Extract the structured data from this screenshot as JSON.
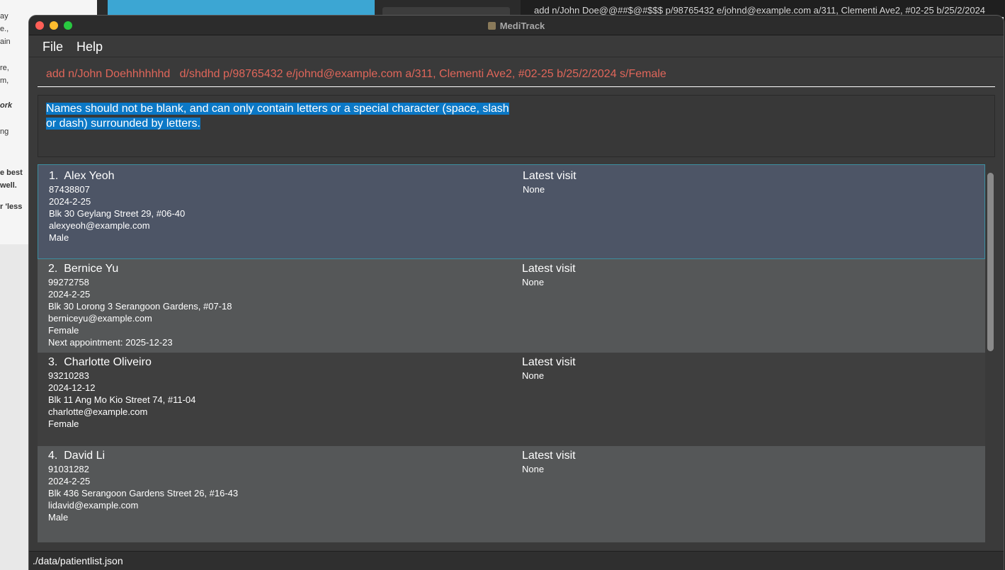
{
  "background": {
    "left_doc_fragments": [
      "ay",
      "e.,",
      "ain",
      "re,",
      "m,",
      "ork",
      "ng",
      "e best",
      "well.",
      "r 'less"
    ],
    "terminal_text": "add n/John Doe@@##$@#$$$ p/98765432 e/johnd@example.com a/311, Clementi Ave2, #02-25 b/25/2/2024"
  },
  "window": {
    "title": "MediTrack",
    "icon": "app-icon"
  },
  "menu": {
    "file": "File",
    "help": "Help"
  },
  "command": {
    "text": "add n/John Doehhhhhhd   d/shdhd p/98765432 e/johnd@example.com a/311, Clementi Ave2, #02-25 b/25/2/2024 s/Female"
  },
  "result": {
    "text": "Names should not be blank, and can only contain letters or a special character (space, slash or dash) surrounded by letters."
  },
  "patients": [
    {
      "name": "1.  Alex Yeoh",
      "phone": "87438807",
      "date": "2024-2-25",
      "address": "Blk 30 Geylang Street 29, #06-40",
      "email": "alexyeoh@example.com",
      "sex": "Male",
      "appointment": "",
      "visit_label": "Latest visit",
      "visit_value": "None"
    },
    {
      "name": "2.  Bernice Yu",
      "phone": "99272758",
      "date": "2024-2-25",
      "address": "Blk 30 Lorong 3 Serangoon Gardens, #07-18",
      "email": "berniceyu@example.com",
      "sex": "Female",
      "appointment": "Next appointment: 2025-12-23",
      "visit_label": "Latest visit",
      "visit_value": "None"
    },
    {
      "name": "3.  Charlotte Oliveiro",
      "phone": "93210283",
      "date": "2024-12-12",
      "address": "Blk 11 Ang Mo Kio Street 74, #11-04",
      "email": "charlotte@example.com",
      "sex": "Female",
      "appointment": "",
      "visit_label": "Latest visit",
      "visit_value": "None"
    },
    {
      "name": "4.  David Li",
      "phone": "91031282",
      "date": "2024-2-25",
      "address": "Blk 436 Serangoon Gardens Street 26, #16-43",
      "email": "lidavid@example.com",
      "sex": "Male",
      "appointment": "",
      "visit_label": "Latest visit",
      "visit_value": "None"
    }
  ],
  "status": {
    "path": "./data/patientlist.json"
  },
  "colors": {
    "command_text": "#e0665a",
    "selection_highlight": "#0b78c6",
    "selected_card": "#4d5566"
  }
}
